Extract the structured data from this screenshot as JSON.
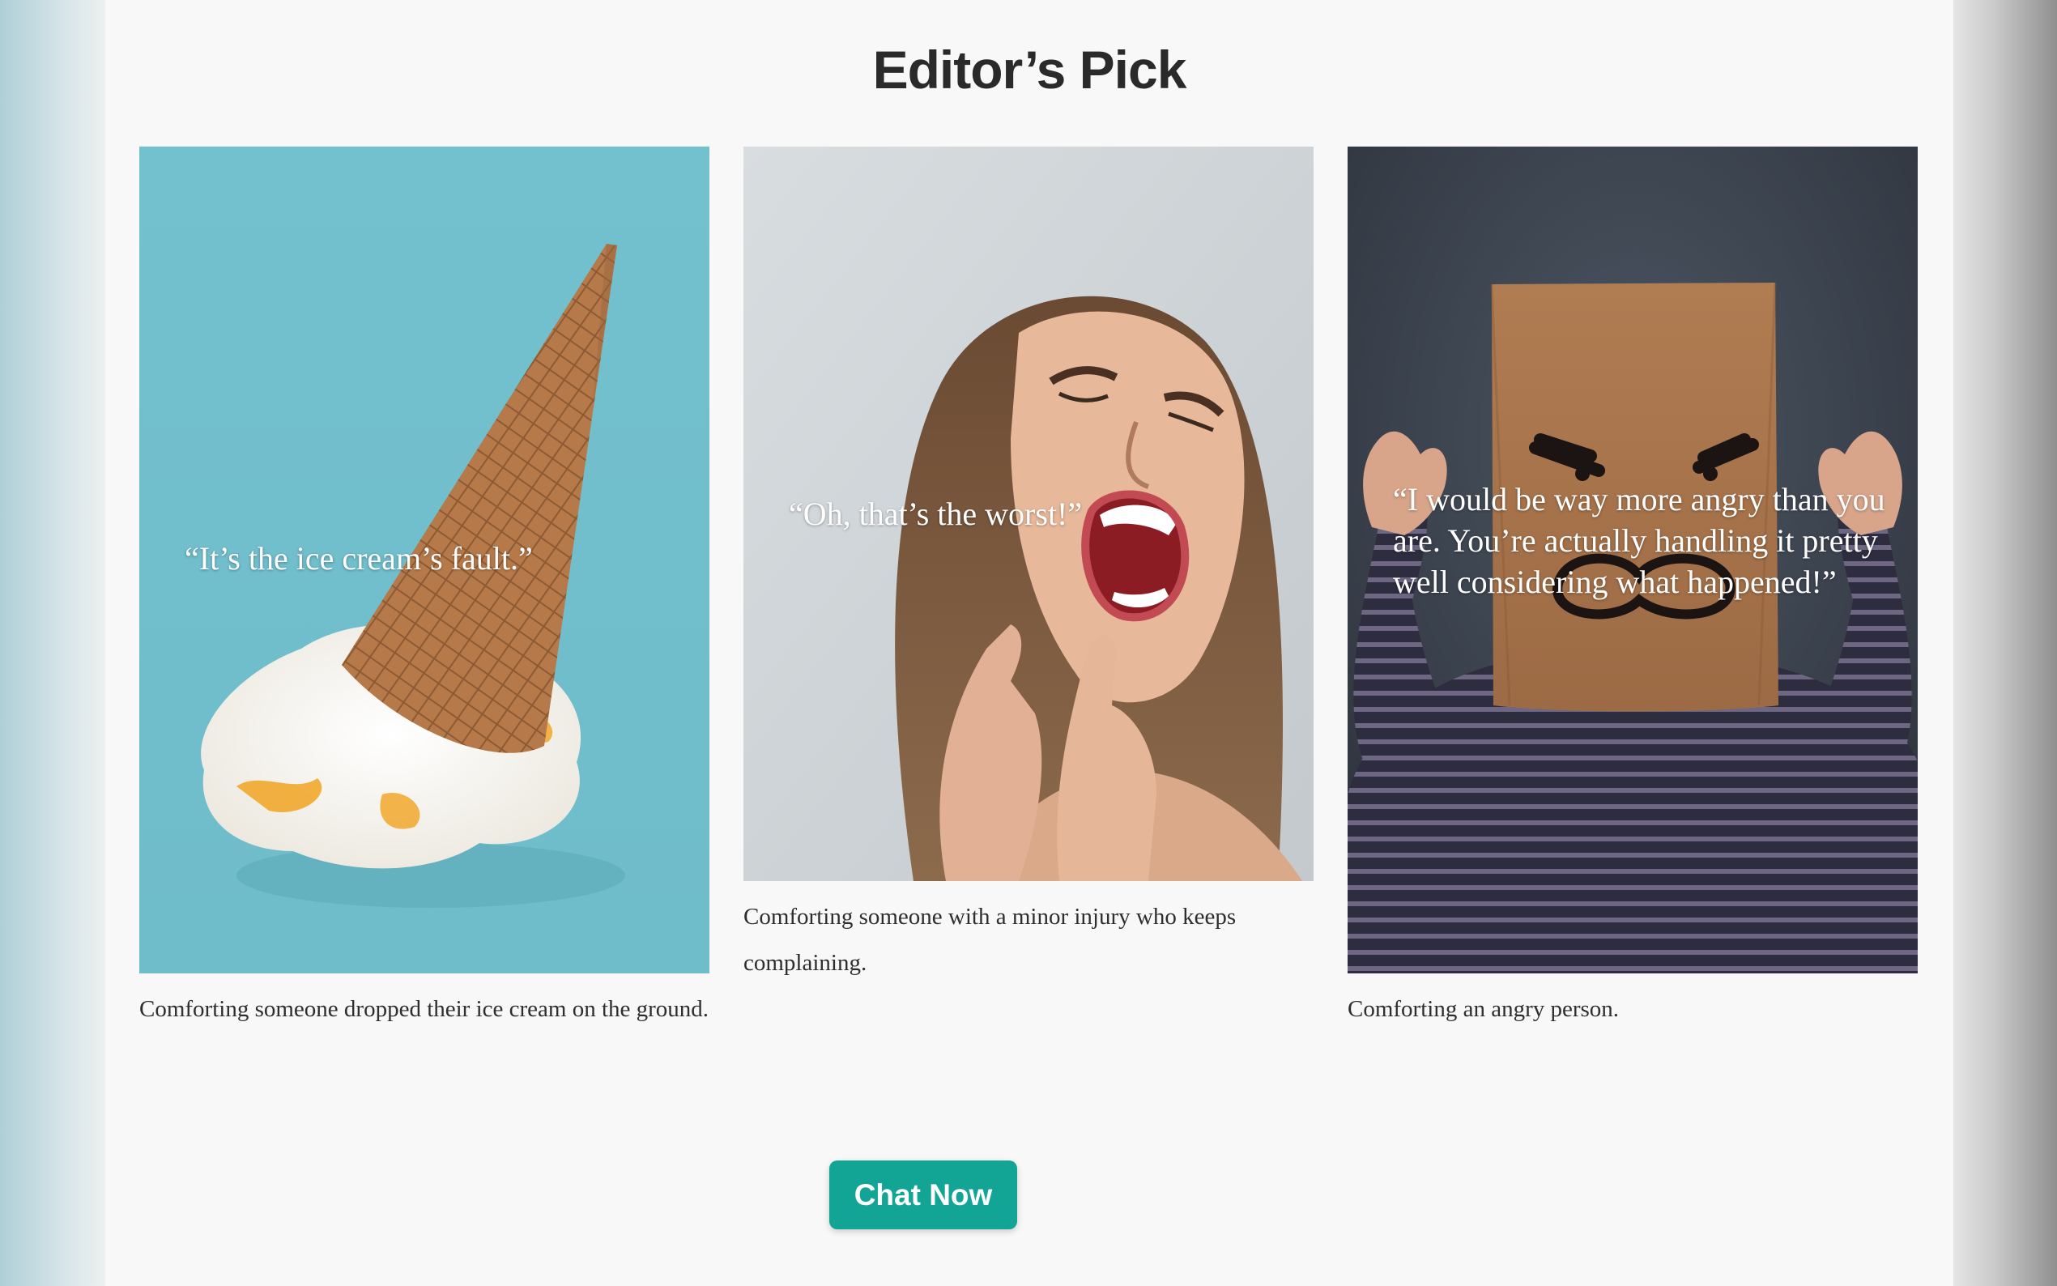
{
  "page": {
    "title": "Editor’s Pick",
    "cards": [
      {
        "quote": "“It’s the ice cream’s fault.”",
        "caption": "Comforting someone dropped their ice cream on the ground.",
        "image": "melted-ice-cream-cone-photo"
      },
      {
        "quote": "“Oh, that’s the worst!”",
        "caption": "Comforting someone with a minor injury who keeps complaining.",
        "image": "woman-screaming-photo"
      },
      {
        "quote": "“I would be way more angry than you are. You’re actually handling it pretty well considering what happened!”",
        "caption": "Comforting an angry person.",
        "image": "angry-paper-bag-person-photo"
      }
    ],
    "cta": {
      "label": "Chat Now",
      "color": "#12a596"
    }
  }
}
